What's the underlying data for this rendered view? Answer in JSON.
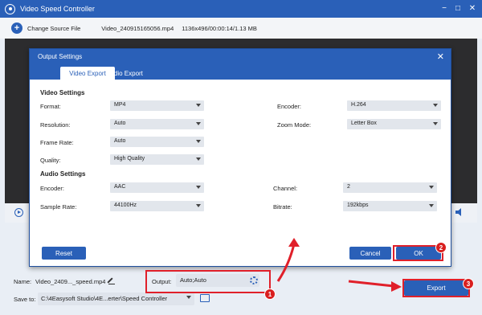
{
  "window": {
    "title": "Video Speed Controller",
    "minimize": "−",
    "maximize": "□",
    "close": "✕"
  },
  "infobar": {
    "change_source": "Change Source File",
    "file_name": "Video_240915165056.mp4",
    "file_meta": "1136x496/00:00:14/1.13 MB"
  },
  "dialog": {
    "title": "Output Settings",
    "close": "✕",
    "tabs": [
      "Video Export",
      "Audio Export"
    ],
    "video_settings_title": "Video Settings",
    "audio_settings_title": "Audio Settings",
    "video": {
      "format": {
        "label": "Format:",
        "value": "MP4"
      },
      "resolution": {
        "label": "Resolution:",
        "value": "Auto"
      },
      "frame_rate": {
        "label": "Frame Rate:",
        "value": "Auto"
      },
      "quality": {
        "label": "Quality:",
        "value": "High Quality"
      },
      "encoder": {
        "label": "Encoder:",
        "value": "H.264"
      },
      "zoom_mode": {
        "label": "Zoom Mode:",
        "value": "Letter Box"
      }
    },
    "audio": {
      "encoder": {
        "label": "Encoder:",
        "value": "AAC"
      },
      "sample_rate": {
        "label": "Sample Rate:",
        "value": "44100Hz"
      },
      "channel": {
        "label": "Channel:",
        "value": "2"
      },
      "bitrate": {
        "label": "Bitrate:",
        "value": "192kbps"
      }
    },
    "reset_label": "Reset",
    "cancel_label": "Cancel",
    "ok_label": "OK"
  },
  "bottom": {
    "name_label": "Name:",
    "name_value": "Video_2409..._speed.mp4",
    "output_label": "Output:",
    "output_value": "Auto;Auto",
    "save_label": "Save to:",
    "save_path": "C:\\4Easysoft Studio\\4E...erter\\Speed Controller",
    "export_label": "Export"
  },
  "annotations": {
    "badge_1": "1",
    "badge_2": "2",
    "badge_3": "3",
    "color": "#e0202a"
  }
}
